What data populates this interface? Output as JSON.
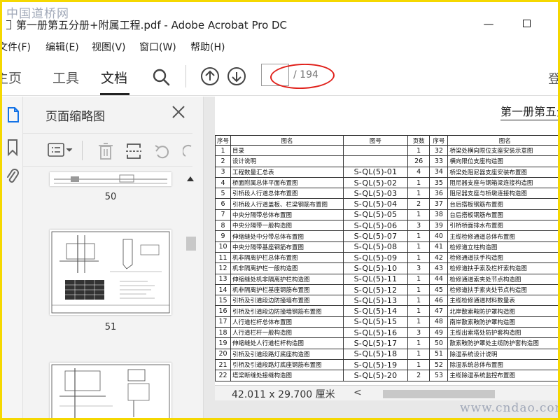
{
  "watermarks": {
    "top": "中国道桥网",
    "bottom": "www.cndao.com"
  },
  "window": {
    "title": "第一册第五分册+附属工程.pdf - Adobe Acrobat Pro DC",
    "minimize": "—"
  },
  "menu": [
    "文件(F)",
    "编辑(E)",
    "视图(V)",
    "窗口(W)",
    "帮助(H)"
  ],
  "toolbar": {
    "tabs": [
      "主页",
      "工具",
      "文档"
    ],
    "active_tab": "文档",
    "page_current": "",
    "page_total": "/ 194",
    "sign_in": "登"
  },
  "panel": {
    "title": "页面缩略图",
    "thumbnails": [
      {
        "number": "50"
      },
      {
        "number": "51"
      },
      {
        "number": ""
      }
    ]
  },
  "document": {
    "heading": "第一册第五分",
    "columns": [
      "序号",
      "图名",
      "图号",
      "页数",
      "序号",
      "图名"
    ],
    "rows": [
      [
        "1",
        "目录",
        "",
        "1",
        "32",
        "桥梁处横向限位支座安装示意图"
      ],
      [
        "2",
        "设计说明",
        "",
        "26",
        "33",
        "横向限位支座构造图"
      ],
      [
        "3",
        "工程数量汇总表",
        "S-QL(5)-01",
        "4",
        "34",
        "桥梁处阻尼器支座安装布置图"
      ],
      [
        "4",
        "桥面附属总体平面布置图",
        "S-QL(5)-02",
        "1",
        "35",
        "阻尼器支座与钢箱梁连接构造图"
      ],
      [
        "5",
        "引桥段人行道总体布置图",
        "S-QL(5)-03",
        "1",
        "36",
        "阻尼器支座与桥墩连接构造图"
      ],
      [
        "6",
        "引桥段人行道盖板、栏梁钢筋布置图",
        "S-QL(5)-04",
        "2",
        "37",
        "台后搭板钢筋布置图"
      ],
      [
        "7",
        "中央分隔带总体布置图",
        "S-QL(5)-05",
        "1",
        "38",
        "台后搭板钢筋布置图"
      ],
      [
        "8",
        "中央分隔带一般构造图",
        "S-QL(5)-06",
        "3",
        "39",
        "引桥桥面排水布置图"
      ],
      [
        "9",
        "伸缩缝处中分带总体布置图",
        "S-QL(5)-07",
        "1",
        "40",
        "主缆检修通道总体布置图"
      ],
      [
        "10",
        "中央分隔带基座钢筋布置图",
        "S-QL(5)-08",
        "1",
        "41",
        "检修道立柱构造图"
      ],
      [
        "11",
        "机非隔离护栏总体布置图",
        "S-QL(5)-09",
        "1",
        "42",
        "检修通道扶手构造图"
      ],
      [
        "12",
        "机非隔离护栏一般构造图",
        "S-QL(5)-10",
        "3",
        "43",
        "检修道扶手索及栏杆索构造图"
      ],
      [
        "13",
        "伸缩缝处机非隔离护栏构造图",
        "S-QL(5)-11",
        "1",
        "44",
        "检修通道索夹处节点构造图"
      ],
      [
        "14",
        "机非隔离护栏基座钢筋布置图",
        "S-QL(5)-12",
        "1",
        "45",
        "检修道扶手索夹处节点构造图"
      ],
      [
        "15",
        "引桥及引道段边防撞墙布置图",
        "S-QL(5)-13",
        "1",
        "46",
        "主缆检修通道材料数量表"
      ],
      [
        "16",
        "引桥及引道段边防撞墙钢筋布置图",
        "S-QL(5)-14",
        "1",
        "47",
        "北岸散索鞍防护罩构造图"
      ],
      [
        "17",
        "人行道栏杆总体布置图",
        "S-QL(5)-15",
        "1",
        "48",
        "南岸散索鞍防护罩构造图"
      ],
      [
        "18",
        "人行道栏杆一般构造图",
        "S-QL(5)-16",
        "3",
        "49",
        "主缆出索塔处防护套构造图"
      ],
      [
        "19",
        "伸缩缝处人行道栏杆构造图",
        "S-QL(5)-17",
        "1",
        "50",
        "散索鞍防护罩处主缆防护套构造图"
      ],
      [
        "20",
        "引桥及引道段路灯底座构造图",
        "S-QL(5)-18",
        "1",
        "51",
        "除湿系统设计说明"
      ],
      [
        "21",
        "引桥及引道段路灯底座钢筋布置图",
        "S-QL(5)-19",
        "1",
        "52",
        "除湿系统总体布置图"
      ],
      [
        "22",
        "塔梁断缝处接缝构造图",
        "S-QL(5)-20",
        "2",
        "53",
        "主缆除湿系统监控布置图"
      ]
    ]
  },
  "status": {
    "dimensions": "42.011 x 29.700 厘米"
  }
}
